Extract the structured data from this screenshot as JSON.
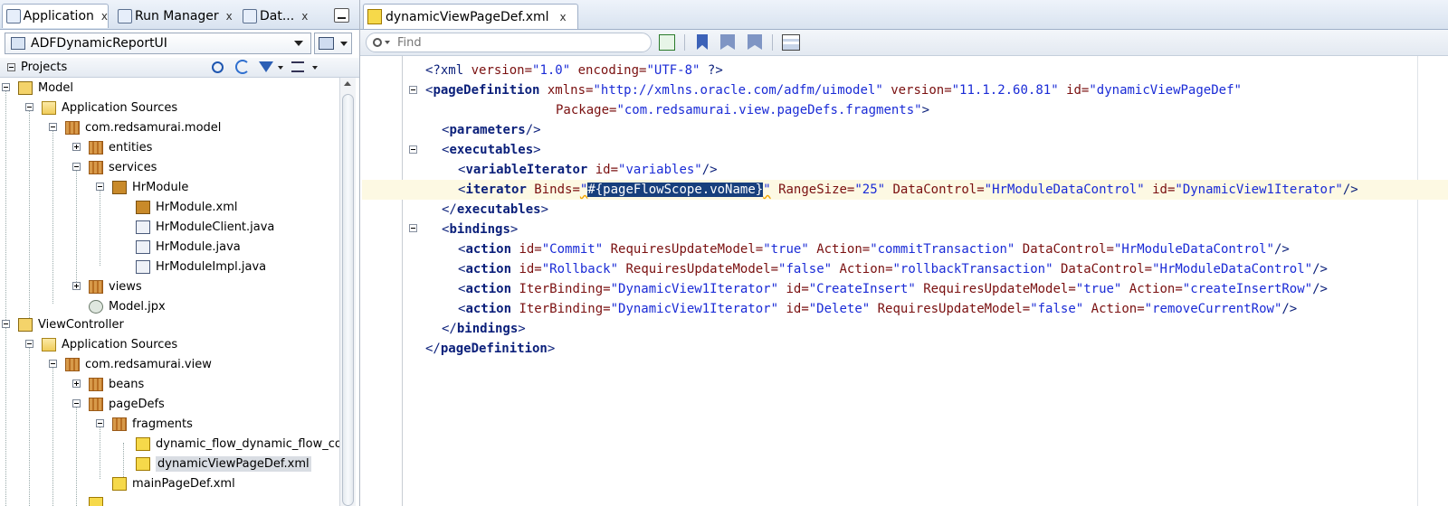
{
  "left_tabs": [
    {
      "label": "Application",
      "close": "x"
    },
    {
      "label": "Run Manager",
      "close": "x"
    },
    {
      "label": "Dat...",
      "close": "x"
    }
  ],
  "app_selector": {
    "value": "ADFDynamicReportUI"
  },
  "projects": {
    "header": "Projects"
  },
  "tree": [
    {
      "label": "Model",
      "icon": "project-icon"
    },
    {
      "label": "Application Sources",
      "icon": "folder-icon"
    },
    {
      "label": "com.redsamurai.model",
      "icon": "package-icon"
    },
    {
      "label": "entities",
      "icon": "package-icon"
    },
    {
      "label": "services",
      "icon": "package-icon"
    },
    {
      "label": "HrModule",
      "icon": "application-module-icon"
    },
    {
      "label": "HrModule.xml",
      "icon": "application-module-icon"
    },
    {
      "label": "HrModuleClient.java",
      "icon": "java-file-icon"
    },
    {
      "label": "HrModule.java",
      "icon": "java-file-icon"
    },
    {
      "label": "HrModuleImpl.java",
      "icon": "java-file-icon"
    },
    {
      "label": "views",
      "icon": "package-icon"
    },
    {
      "label": "Model.jpx",
      "icon": "jpx-file-icon"
    },
    {
      "label": "ViewController",
      "icon": "project-icon"
    },
    {
      "label": "Application Sources",
      "icon": "folder-icon"
    },
    {
      "label": "com.redsamurai.view",
      "icon": "package-icon"
    },
    {
      "label": "beans",
      "icon": "package-icon"
    },
    {
      "label": "pageDefs",
      "icon": "package-icon"
    },
    {
      "label": "fragments",
      "icon": "package-icon"
    },
    {
      "label": "dynamic_flow_dynamic_flow_coi",
      "icon": "xml-file-icon"
    },
    {
      "label": "dynamicViewPageDef.xml",
      "icon": "xml-file-icon"
    },
    {
      "label": "mainPageDef.xml",
      "icon": "xml-file-icon"
    }
  ],
  "editor": {
    "tab_label": "dynamicViewPageDef.xml",
    "tab_close": "x",
    "find_placeholder": "Find"
  },
  "code": {
    "l1": {
      "a": "<?xml",
      "b": " version=",
      "c": "\"1.0\"",
      "d": " encoding=",
      "e": "\"UTF-8\"",
      "f": " ?>"
    },
    "l2": {
      "a": "<",
      "b": "pageDefinition",
      "c": " xmlns=",
      "d": "\"http://xmlns.oracle.com/adfm/uimodel\"",
      "e": " version=",
      "f": "\"11.1.2.60.81\"",
      "g": " id=",
      "h": "\"dynamicViewPageDef\""
    },
    "l3": {
      "a": "Package=",
      "b": "\"com.redsamurai.view.pageDefs.fragments\"",
      "c": ">"
    },
    "l4": {
      "a": "<",
      "b": "parameters",
      "c": "/>"
    },
    "l5": {
      "a": "<",
      "b": "executables",
      "c": ">"
    },
    "l6": {
      "a": "<",
      "b": "variableIterator",
      "c": " id=",
      "d": "\"variables\"",
      "e": "/>"
    },
    "l7": {
      "a": "<",
      "b": "iterator",
      "c": " Binds=",
      "d": "\"",
      "sel": "#{pageFlowScope.voName}",
      "e": "\"",
      "f": " RangeSize=",
      "g": "\"25\"",
      "h": " DataControl=",
      "i": "\"HrModuleDataControl\"",
      "j": " id=",
      "k": "\"DynamicView1Iterator\"",
      "l": "/>"
    },
    "l8": {
      "a": "</",
      "b": "executables",
      "c": ">"
    },
    "l9": {
      "a": "<",
      "b": "bindings",
      "c": ">"
    },
    "l10": {
      "a": "<",
      "b": "action",
      "c": " id=",
      "d": "\"Commit\"",
      "e": " RequiresUpdateModel=",
      "f": "\"true\"",
      "g": " Action=",
      "h": "\"commitTransaction\"",
      "i": " DataControl=",
      "j": "\"HrModuleDataControl\"",
      "k": "/>"
    },
    "l11": {
      "a": "<",
      "b": "action",
      "c": " id=",
      "d": "\"Rollback\"",
      "e": " RequiresUpdateModel=",
      "f": "\"false\"",
      "g": " Action=",
      "h": "\"rollbackTransaction\"",
      "i": " DataControl=",
      "j": "\"HrModuleDataControl\"",
      "k": "/>"
    },
    "l12": {
      "a": "<",
      "b": "action",
      "c": " IterBinding=",
      "d": "\"DynamicView1Iterator\"",
      "e": " id=",
      "f": "\"CreateInsert\"",
      "g": " RequiresUpdateModel=",
      "h": "\"true\"",
      "i": " Action=",
      "j": "\"createInsertRow\"",
      "k": "/>"
    },
    "l13": {
      "a": "<",
      "b": "action",
      "c": " IterBinding=",
      "d": "\"DynamicView1Iterator\"",
      "e": " id=",
      "f": "\"Delete\"",
      "g": " RequiresUpdateModel=",
      "h": "\"false\"",
      "i": " Action=",
      "j": "\"removeCurrentRow\"",
      "k": "/>"
    },
    "l14": {
      "a": "</",
      "b": "bindings",
      "c": ">"
    },
    "l15": {
      "a": "</",
      "b": "pageDefinition",
      "c": ">"
    }
  },
  "colors": {
    "selection": "#173f7d",
    "current_line": "#fdf9e3",
    "tag": "#0a1f7a",
    "attribute": "#7a1010",
    "value": "#1a2bd6"
  }
}
